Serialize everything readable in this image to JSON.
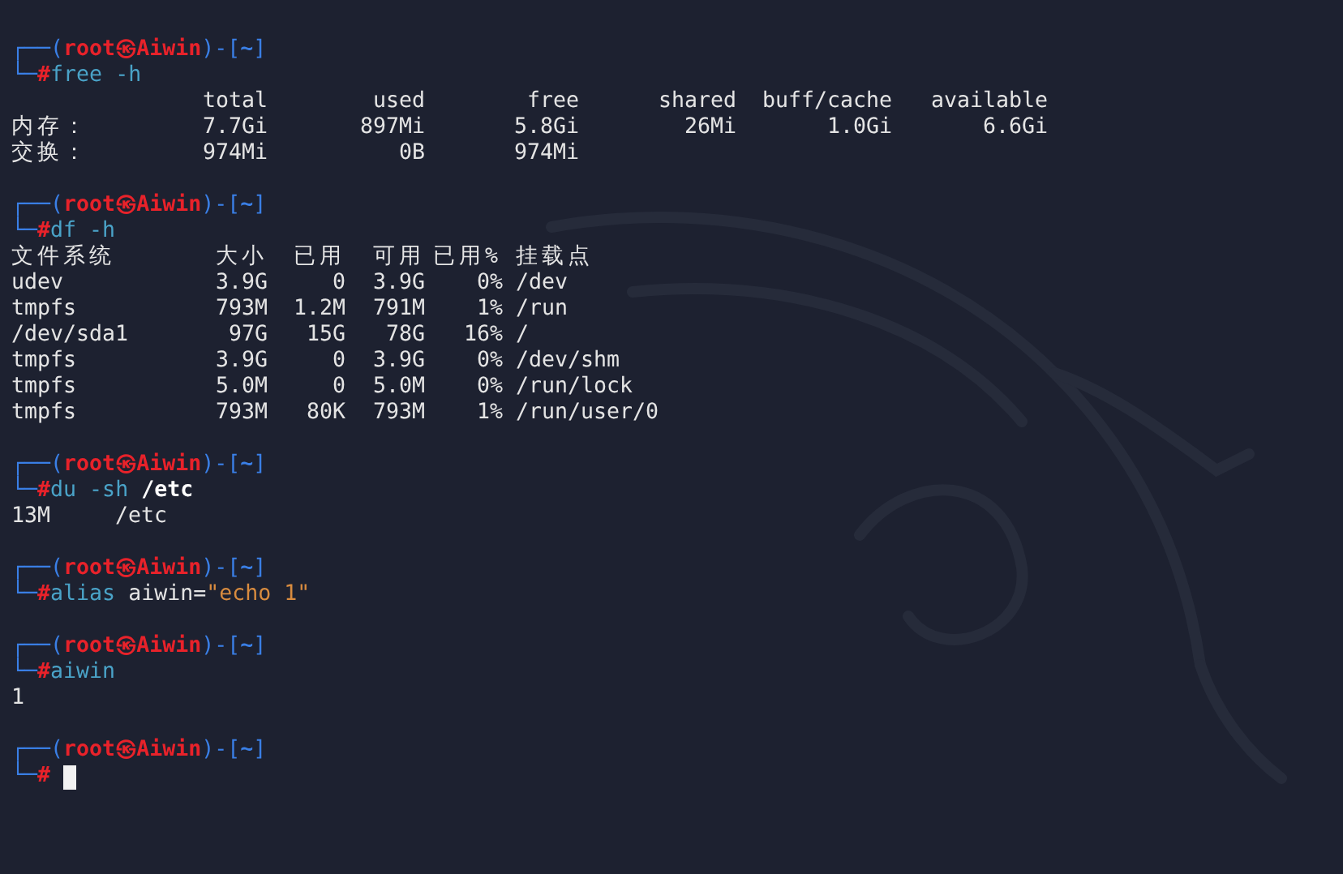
{
  "terminal": {
    "blocks": [
      {
        "prompt": {
          "open": "┌──(",
          "user": "root",
          "at": "㉿",
          "host": "Aiwin",
          "mid": ")-[",
          "dir": "~",
          "close": "]",
          "corner": "└─",
          "sign": "#"
        },
        "command": [
          {
            "kind": "command",
            "text": "free"
          },
          {
            "kind": "option",
            "text": " -h"
          }
        ],
        "output": {
          "kind": "free",
          "header": [
            "total",
            "used",
            "free",
            "shared",
            "buff/cache",
            "available"
          ],
          "rows": [
            [
              "内存：",
              "7.7Gi",
              "897Mi",
              "5.8Gi",
              "26Mi",
              "1.0Gi",
              "6.6Gi"
            ],
            [
              "交换：",
              "974Mi",
              "0B",
              "974Mi"
            ]
          ]
        }
      },
      {
        "prompt": {
          "open": "┌──(",
          "user": "root",
          "at": "㉿",
          "host": "Aiwin",
          "mid": ")-[",
          "dir": "~",
          "close": "]",
          "corner": "└─",
          "sign": "#"
        },
        "command": [
          {
            "kind": "command",
            "text": "df"
          },
          {
            "kind": "option",
            "text": " -h"
          }
        ],
        "output": {
          "kind": "df",
          "header": [
            "文件系统",
            "大小",
            "已用",
            "可用",
            "已用%",
            "挂载点"
          ],
          "rows": [
            [
              "udev",
              "3.9G",
              "0",
              "3.9G",
              "0%",
              "/dev"
            ],
            [
              "tmpfs",
              "793M",
              "1.2M",
              "791M",
              "1%",
              "/run"
            ],
            [
              "/dev/sda1",
              "97G",
              "15G",
              "78G",
              "16%",
              "/"
            ],
            [
              "tmpfs",
              "3.9G",
              "0",
              "3.9G",
              "0%",
              "/dev/shm"
            ],
            [
              "tmpfs",
              "5.0M",
              "0",
              "5.0M",
              "0%",
              "/run/lock"
            ],
            [
              "tmpfs",
              "793M",
              "80K",
              "793M",
              "1%",
              "/run/user/0"
            ]
          ]
        }
      },
      {
        "prompt": {
          "open": "┌──(",
          "user": "root",
          "at": "㉿",
          "host": "Aiwin",
          "mid": ")-[",
          "dir": "~",
          "close": "]",
          "corner": "└─",
          "sign": "#"
        },
        "command": [
          {
            "kind": "command",
            "text": "du"
          },
          {
            "kind": "option",
            "text": " -sh"
          },
          {
            "kind": "path",
            "text": " /etc"
          }
        ],
        "output": {
          "kind": "text",
          "lines": [
            "13M     /etc"
          ]
        }
      },
      {
        "prompt": {
          "open": "┌──(",
          "user": "root",
          "at": "㉿",
          "host": "Aiwin",
          "mid": ")-[",
          "dir": "~",
          "close": "]",
          "corner": "└─",
          "sign": "#"
        },
        "command": [
          {
            "kind": "command",
            "text": "alias"
          },
          {
            "kind": "word",
            "text": " aiwin="
          },
          {
            "kind": "string",
            "text": "\"echo 1\""
          }
        ]
      },
      {
        "prompt": {
          "open": "┌──(",
          "user": "root",
          "at": "㉿",
          "host": "Aiwin",
          "mid": ")-[",
          "dir": "~",
          "close": "]",
          "corner": "└─",
          "sign": "#"
        },
        "command": [
          {
            "kind": "command",
            "text": "aiwin"
          }
        ],
        "output": {
          "kind": "text",
          "lines": [
            "1"
          ]
        }
      },
      {
        "prompt": {
          "open": "┌──(",
          "user": "root",
          "at": "㉿",
          "host": "Aiwin",
          "mid": ")-[",
          "dir": "~",
          "close": "]",
          "corner": "└─",
          "sign": "#"
        },
        "cursor": true
      }
    ]
  }
}
